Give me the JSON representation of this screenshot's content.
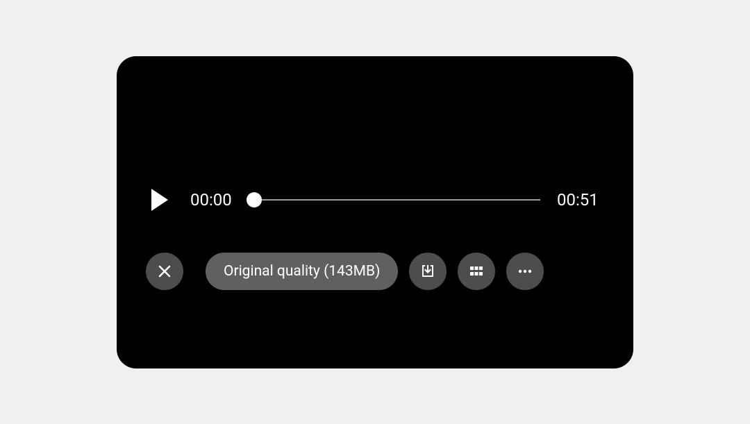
{
  "player": {
    "current_time": "00:00",
    "duration": "00:51",
    "quality_label": "Original quality (143MB)"
  }
}
